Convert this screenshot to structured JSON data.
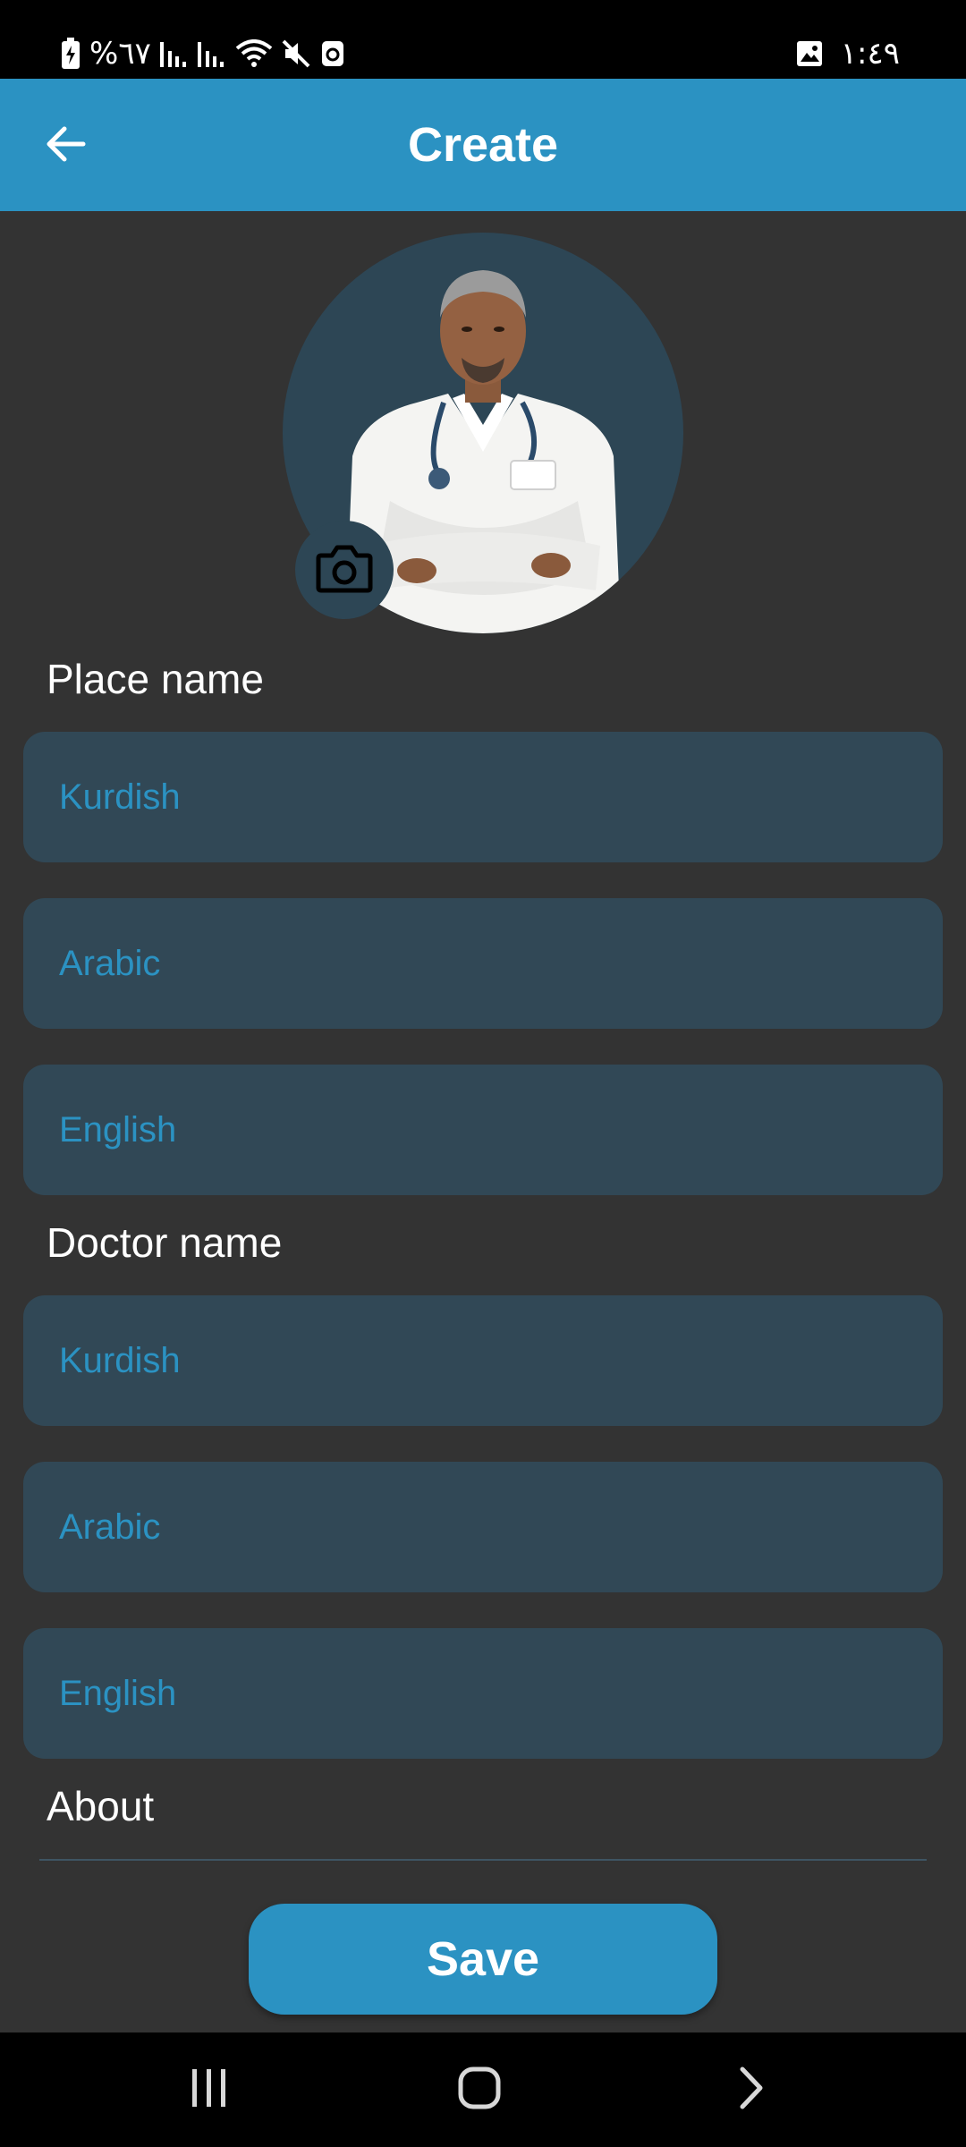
{
  "status_bar": {
    "battery_percent": "%٦٧",
    "time": "١:٤٩",
    "icons": [
      "battery-charging-icon",
      "signal-icon",
      "signal-icon",
      "wifi-icon",
      "mute-icon",
      "recycle-icon",
      "gallery-icon"
    ]
  },
  "app_bar": {
    "title": "Create",
    "back_icon": "arrow-left-icon"
  },
  "avatar": {
    "camera_icon": "camera-icon"
  },
  "place_name": {
    "label": "Place name",
    "fields": [
      {
        "placeholder": "Kurdish",
        "value": ""
      },
      {
        "placeholder": "Arabic",
        "value": ""
      },
      {
        "placeholder": "English",
        "value": ""
      }
    ]
  },
  "doctor_name": {
    "label": "Doctor name",
    "fields": [
      {
        "placeholder": "Kurdish",
        "value": ""
      },
      {
        "placeholder": "Arabic",
        "value": ""
      },
      {
        "placeholder": "English",
        "value": ""
      }
    ]
  },
  "about": {
    "label": "About",
    "value": ""
  },
  "save_button": {
    "label": "Save"
  },
  "nav_bar": {
    "icons": [
      "recent-apps-icon",
      "home-icon",
      "back-chevron-icon"
    ]
  },
  "colors": {
    "accent": "#2b92c2",
    "background": "#333333",
    "field_background": "#314856"
  }
}
